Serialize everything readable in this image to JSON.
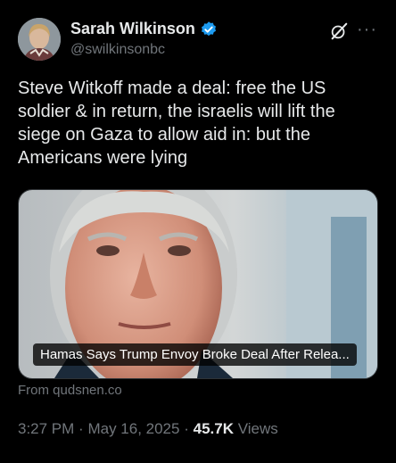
{
  "author": {
    "display_name": "Sarah Wilkinson",
    "handle": "@swilkinsonbc",
    "verified": true
  },
  "icons": {
    "avatar": "avatar",
    "verified": "verified-badge-icon",
    "grok": "grok-icon",
    "more": "more-icon"
  },
  "tweet": {
    "text": "Steve Witkoff made a deal: free the US soldier & in return, the israelis will lift the siege on Gaza to allow aid in: but the Americans were lying"
  },
  "card": {
    "title": "Hamas Says Trump Envoy Broke Deal After Relea...",
    "source": "From qudsnen.co"
  },
  "meta": {
    "time": "3:27 PM",
    "separator": "·",
    "date": "May 16, 2025",
    "views_count": "45.7K",
    "views_label": "Views"
  },
  "colors": {
    "background": "#000000",
    "text": "#e7e9ea",
    "secondary": "#71767b",
    "verified": "#1d9bf0"
  }
}
